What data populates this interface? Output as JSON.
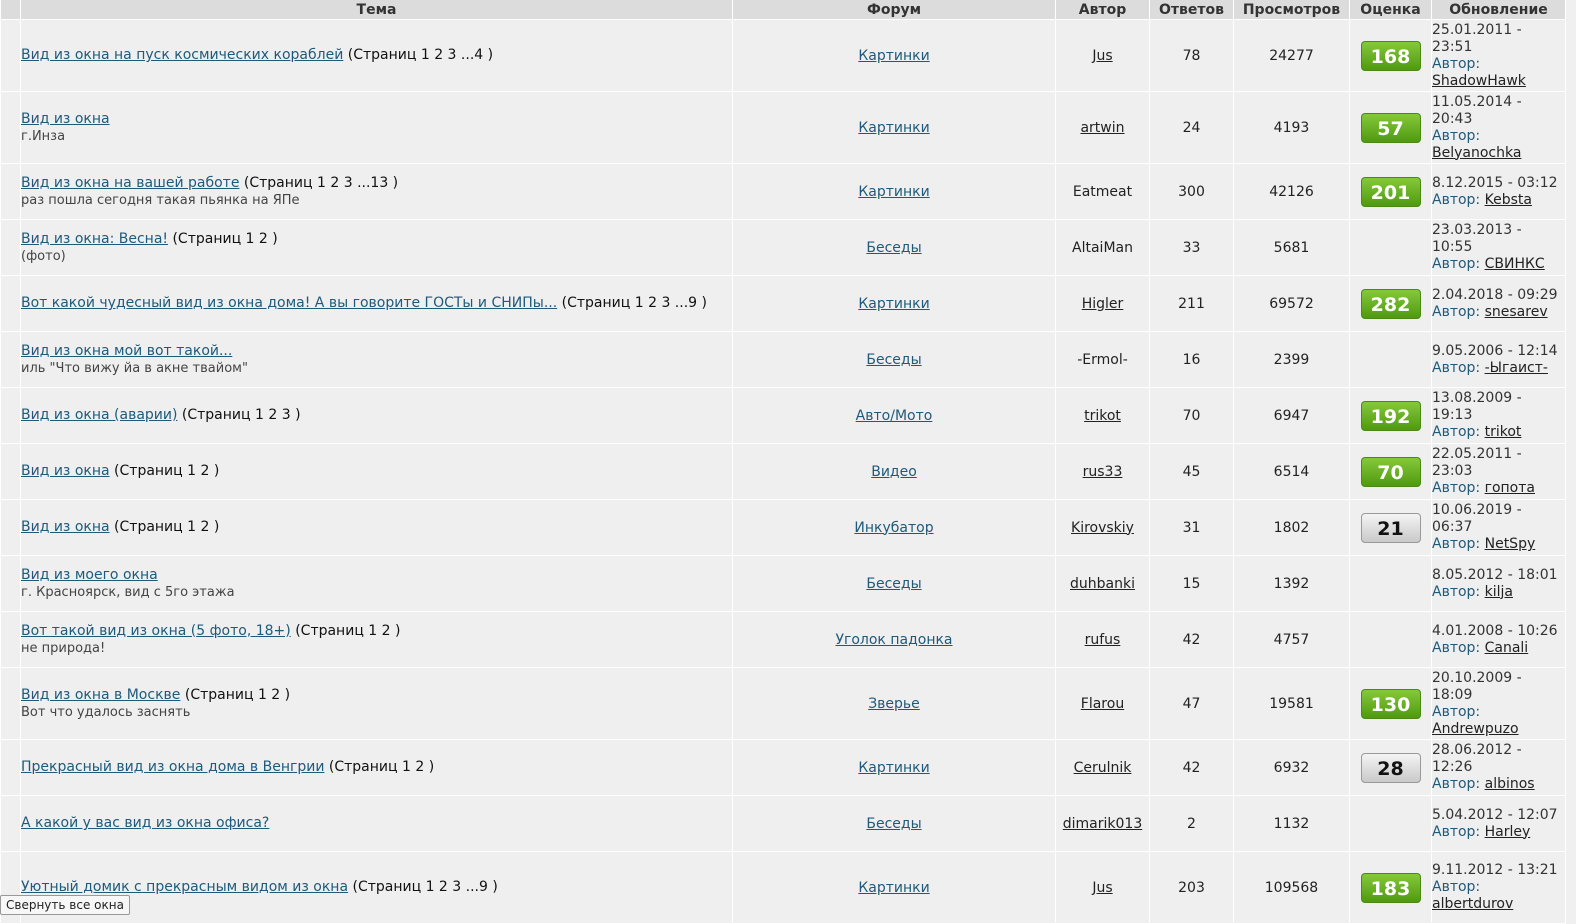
{
  "headers": {
    "topic": "Тема",
    "forum": "Форум",
    "author": "Автор",
    "replies": "Ответов",
    "views": "Просмотров",
    "rating": "Оценка",
    "updated": "Обновление"
  },
  "collapse_button": "Свернуть все окна",
  "author_label": "Автор:",
  "colors": {
    "link": "#1f5a7a",
    "rating_green": "#5fa81c",
    "rating_gray": "#d4d4d4"
  },
  "rows": [
    {
      "title": "Вид из окна на пуск космических кораблей",
      "pages": "(Страниц 1 2 3 ...4 )",
      "desc": "",
      "forum": "Картинки",
      "author": "Jus",
      "author_link": true,
      "replies": "78",
      "views": "24277",
      "rating": "168",
      "rating_color": "green",
      "date": "25.01.2011 - 23:51",
      "last": "ShadowHawk",
      "height": 72
    },
    {
      "title": "Вид из окна",
      "pages": "",
      "desc": "г.Инза",
      "forum": "Картинки",
      "author": "artwin",
      "author_link": true,
      "replies": "24",
      "views": "4193",
      "rating": "57",
      "rating_color": "green",
      "date": "11.05.2014 - 20:43",
      "last": "Belyanochka",
      "height": 72
    },
    {
      "title": "Вид из окна на вашей работе",
      "pages": "(Страниц 1 2 3 ...13 )",
      "desc": "раз пошла сегодня такая пьянка на ЯПе",
      "forum": "Картинки",
      "author": "Eatmeat",
      "author_link": false,
      "replies": "300",
      "views": "42126",
      "rating": "201",
      "rating_color": "green",
      "date": "8.12.2015 - 03:12",
      "last": "Kebsta",
      "height": 56
    },
    {
      "title": "Вид из окна: Весна!",
      "pages": "(Страниц 1 2 )",
      "desc": "(фото)",
      "forum": "Беседы",
      "author": "AltaiMan",
      "author_link": false,
      "replies": "33",
      "views": "5681",
      "rating": "",
      "rating_color": "",
      "date": "23.03.2013 - 10:55",
      "last": "СВИНКС",
      "height": 56
    },
    {
      "title": "Вот какой чудесный вид из окна дома! А вы говорите ГОСТы и СНИПы...",
      "pages": "(Страниц 1 2 3 ...9 )",
      "desc": "",
      "forum": "Картинки",
      "author": "Higler",
      "author_link": true,
      "replies": "211",
      "views": "69572",
      "rating": "282",
      "rating_color": "green",
      "date": "2.04.2018 - 09:29",
      "last": "snesarev",
      "height": 56
    },
    {
      "title": "Вид из окна мой вот такой...",
      "pages": "",
      "desc": "иль \"Что вижу йа в акне твайом\"",
      "forum": "Беседы",
      "author": "-Ermol-",
      "author_link": false,
      "replies": "16",
      "views": "2399",
      "rating": "",
      "rating_color": "",
      "date": "9.05.2006 - 12:14",
      "last": "-Ыгаист-",
      "height": 56
    },
    {
      "title": "Вид из окна (аварии)",
      "pages": "(Страниц 1 2 3 )",
      "desc": "",
      "forum": "Авто/Мото",
      "author": "trikot",
      "author_link": true,
      "replies": "70",
      "views": "6947",
      "rating": "192",
      "rating_color": "green",
      "date": "13.08.2009 - 19:13",
      "last": "trikot",
      "height": 56
    },
    {
      "title": "Вид из окна",
      "pages": "(Страниц 1 2 )",
      "desc": "",
      "forum": "Видео",
      "author": "rus33",
      "author_link": true,
      "replies": "45",
      "views": "6514",
      "rating": "70",
      "rating_color": "green",
      "date": "22.05.2011 - 23:03",
      "last": "гопота",
      "height": 56
    },
    {
      "title": "Вид из окна",
      "pages": "(Страниц 1 2 )",
      "desc": "",
      "forum": "Инкубатор",
      "author": "Kirovskiy",
      "author_link": true,
      "replies": "31",
      "views": "1802",
      "rating": "21",
      "rating_color": "gray",
      "date": "10.06.2019 - 06:37",
      "last": "NetSpy",
      "height": 56
    },
    {
      "title": "Вид из моего окна",
      "pages": "",
      "desc": "г. Красноярск, вид с 5го этажа",
      "forum": "Беседы",
      "author": "duhbanki",
      "author_link": true,
      "replies": "15",
      "views": "1392",
      "rating": "",
      "rating_color": "",
      "date": "8.05.2012 - 18:01",
      "last": "kilja",
      "height": 56
    },
    {
      "title": "Вот такой вид из окна (5 фото, 18+)",
      "pages": "(Страниц 1 2 )",
      "desc": "не природа!",
      "forum": "Уголок падонка",
      "author": "rufus",
      "author_link": true,
      "replies": "42",
      "views": "4757",
      "rating": "",
      "rating_color": "",
      "date": "4.01.2008 - 10:26",
      "last": "Canali",
      "height": 56
    },
    {
      "title": "Вид из окна в Москве",
      "pages": "(Страниц 1 2 )",
      "desc": "Вот что удалось заснять",
      "forum": "Зверье",
      "author": "Flarou",
      "author_link": true,
      "replies": "47",
      "views": "19581",
      "rating": "130",
      "rating_color": "green",
      "date": "20.10.2009 - 18:09",
      "last": "Andrewpuzo",
      "height": 72
    },
    {
      "title": "Прекрасный вид из окна дома в Венгрии",
      "pages": "(Страниц 1 2 )",
      "desc": "",
      "forum": "Картинки",
      "author": "Cerulnik",
      "author_link": true,
      "replies": "42",
      "views": "6932",
      "rating": "28",
      "rating_color": "gray",
      "date": "28.06.2012 - 12:26",
      "last": "albinos",
      "height": 56
    },
    {
      "title": "А какой у вас вид из окна офиса?",
      "pages": "",
      "desc": "",
      "forum": "Беседы",
      "author": "dimarik013",
      "author_link": true,
      "replies": "2",
      "views": "1132",
      "rating": "",
      "rating_color": "",
      "date": "5.04.2012 - 12:07",
      "last": "Harley",
      "height": 56
    },
    {
      "title": "Уютный домик с прекрасным видом из окна",
      "pages": "(Страниц 1 2 3 ...9 )",
      "desc": "",
      "forum": "Картинки",
      "author": "Jus",
      "author_link": true,
      "replies": "203",
      "views": "109568",
      "rating": "183",
      "rating_color": "green",
      "date": "9.11.2012 - 13:21",
      "last": "albertdurov",
      "height": 72
    }
  ]
}
